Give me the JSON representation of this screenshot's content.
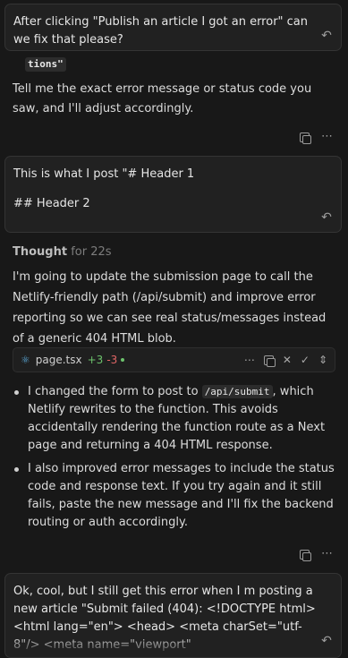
{
  "messages": {
    "user1": "After clicking \"Publish an article I got an error\" can we fix that please?",
    "assistant1_code_fragment": "tions\"",
    "assistant1_text": "Tell me the exact error message or status code you saw, and I'll adjust accordingly.",
    "user2_line1": "This is what I post \"# Header 1",
    "user2_line2": "## Header 2",
    "thought_label": "Thought",
    "thought_time": "for 22s",
    "assistant2_intro": "I'm going to update the submission page to call the Netlify-friendly path (/api/submit) and improve error reporting so we can see real status/messages instead of a generic 404 HTML blob.",
    "file": {
      "name": "page.tsx",
      "added": "+3",
      "removed": "-3"
    },
    "bullet1_pre": "I changed the form to post to ",
    "bullet1_code": "/api/submit",
    "bullet1_post": ", which Netlify rewrites to the function. This avoids accidentally rendering the function route as a Next page and returning a 404 HTML response.",
    "bullet2": "I also improved error messages to include the status code and response text. If you try again and it still fails, paste the new message and I'll fix the backend routing or auth accordingly.",
    "user3": "Ok, cool, but I still get this error when I m posting a new article \"Submit failed (404): <!DOCTYPE html> <html lang=\"en\"> <head> <meta charSet=\"utf-8\"/> <meta name=\"viewport\" content=\"width=device-width, initial-"
  },
  "icons": {
    "undo": "undo-icon",
    "copy": "copy-icon",
    "more": "more-icon",
    "react": "react-icon",
    "close": "close-icon",
    "check": "check-icon",
    "expand": "expand-icon"
  }
}
